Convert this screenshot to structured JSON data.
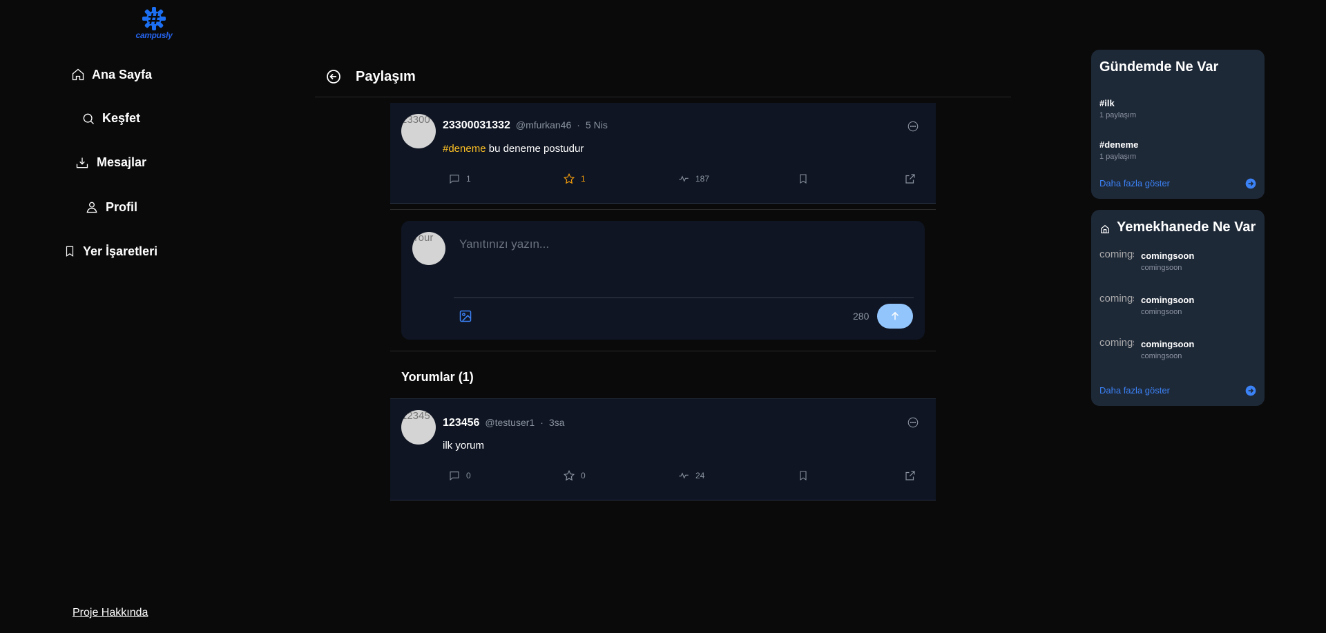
{
  "app": {
    "logo_text": "campusly",
    "accent": "#2563eb"
  },
  "nav": {
    "items": [
      {
        "label": "Ana Sayfa",
        "icon": "home-icon"
      },
      {
        "label": "Keşfet",
        "icon": "search-icon"
      },
      {
        "label": "Mesajlar",
        "icon": "inbox-icon"
      },
      {
        "label": "Profil",
        "icon": "user-icon"
      },
      {
        "label": "Yer İşaretleri",
        "icon": "bookmark-icon"
      }
    ],
    "footer": "Proje Hakkında"
  },
  "header": {
    "title": "Paylaşım"
  },
  "post": {
    "avatar_alt": "23300",
    "author": "23300031332",
    "handle": "@mfurkan46",
    "time": "5 Nis",
    "hashtag": "#deneme",
    "text": " bu deneme postudur",
    "comments": "1",
    "stars": "1",
    "views": "187"
  },
  "reply": {
    "avatar_alt": "Your",
    "placeholder": "Yanıtınızı yazın...",
    "char_count": "280"
  },
  "comments": {
    "title": "Yorumlar (1)",
    "items": [
      {
        "avatar_alt": "12345",
        "author": "123456",
        "handle": "@testuser1",
        "time": "3sa",
        "text": "ilk yorum",
        "comments": "0",
        "stars": "0",
        "views": "24"
      }
    ]
  },
  "trending": {
    "title": "Gündemde Ne Var",
    "items": [
      {
        "tag": "#ilk",
        "count": "1 paylaşım"
      },
      {
        "tag": "#deneme",
        "count": "1 paylaşım"
      }
    ],
    "show_more": "Daha fazla göster"
  },
  "cafeteria": {
    "title": "Yemekhanede Ne Var",
    "items": [
      {
        "thumb_alt": "comingsoon",
        "name": "comingsoon",
        "sub": "comingsoon"
      },
      {
        "thumb_alt": "comingsoon",
        "name": "comingsoon",
        "sub": "comingsoon"
      },
      {
        "thumb_alt": "comingsoon",
        "name": "comingsoon",
        "sub": "comingsoon"
      }
    ],
    "show_more": "Daha fazla göster"
  }
}
